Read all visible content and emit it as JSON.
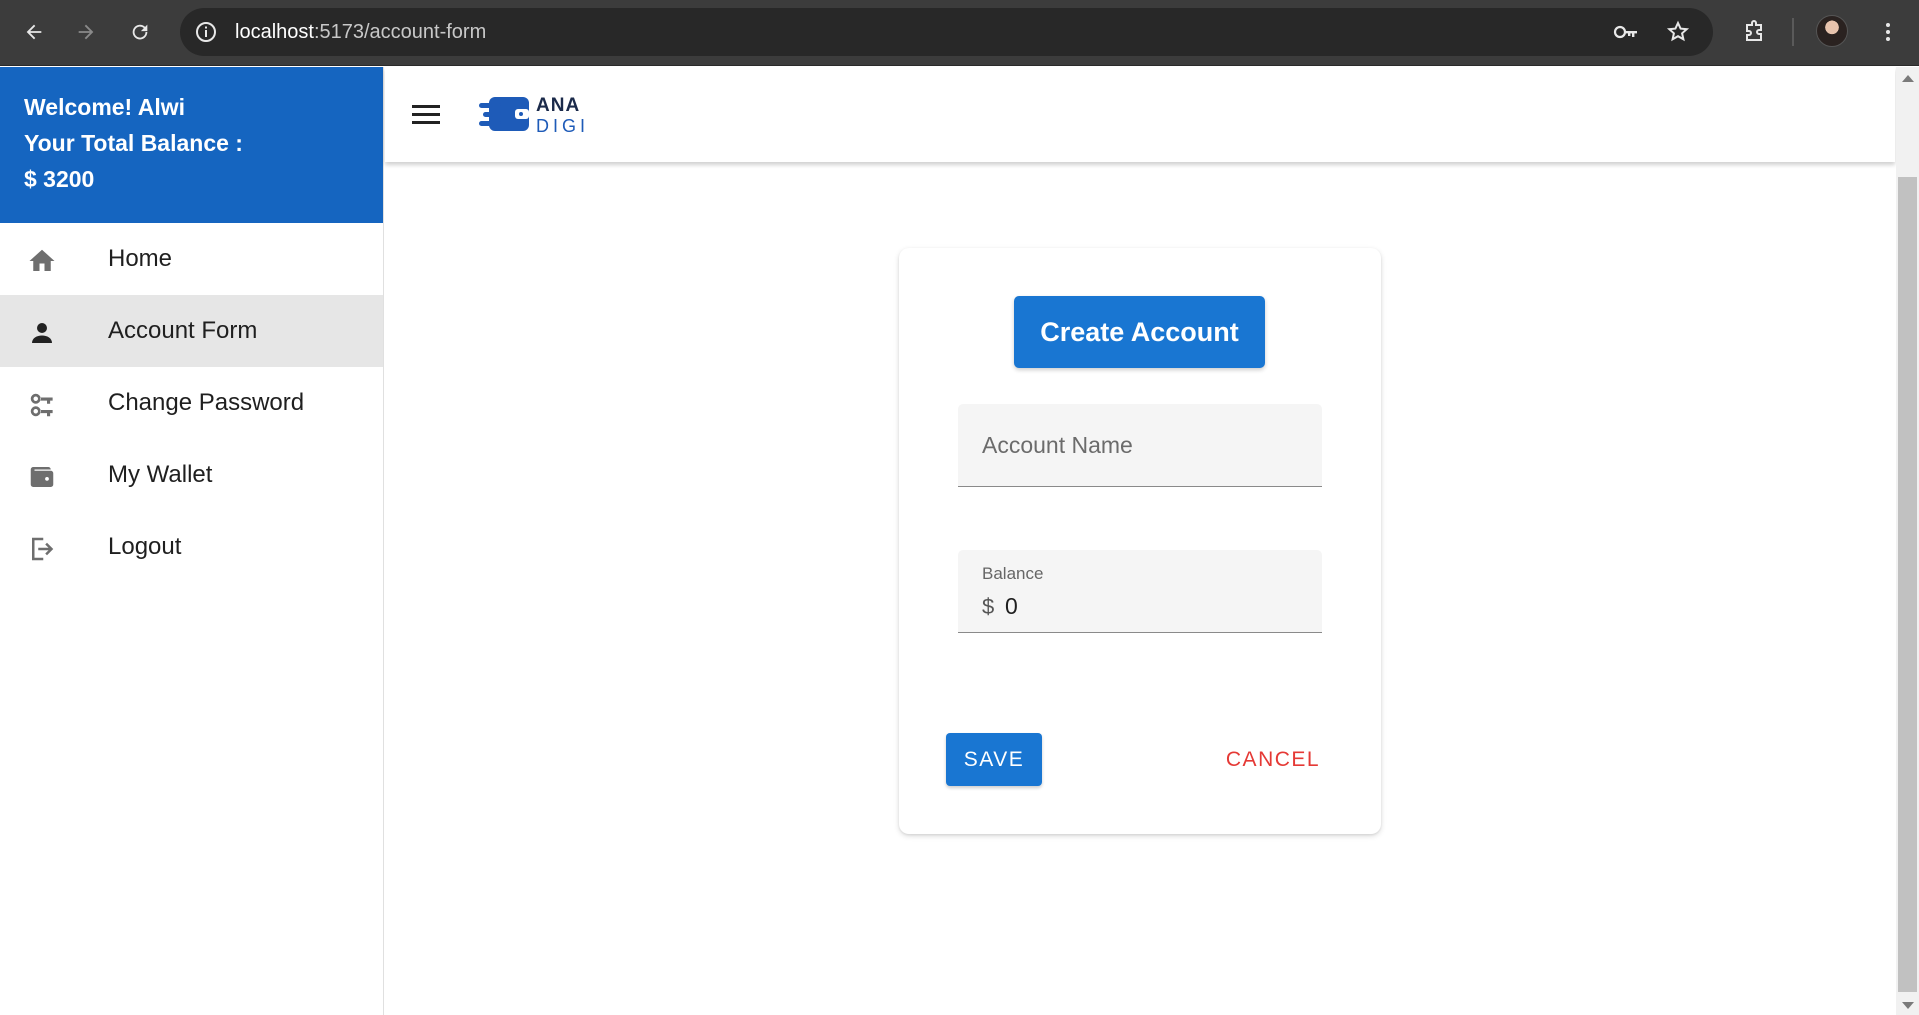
{
  "browser": {
    "url_host": "localhost",
    "url_path": ":5173/account-form"
  },
  "sidebar": {
    "welcome": "Welcome! Alwi",
    "balance_label": "Your Total Balance :",
    "balance_value": "$ 3200",
    "items": [
      {
        "label": "Home",
        "icon": "home-icon"
      },
      {
        "label": "Account Form",
        "icon": "person-icon",
        "active": true
      },
      {
        "label": "Change Password",
        "icon": "key-icon"
      },
      {
        "label": "My Wallet",
        "icon": "wallet-icon"
      },
      {
        "label": "Logout",
        "icon": "logout-icon"
      }
    ]
  },
  "appbar": {
    "logo_top": "ANA",
    "logo_bottom": "DIGI"
  },
  "form": {
    "title": "Create Account",
    "account_name_placeholder": "Account Name",
    "balance_label": "Balance",
    "balance_adornment": "$",
    "balance_value": "0",
    "save_label": "SAVE",
    "cancel_label": "CANCEL"
  },
  "colors": {
    "primary": "#1976d2",
    "sidebar_header": "#1565c0",
    "cancel": "#e53935"
  }
}
